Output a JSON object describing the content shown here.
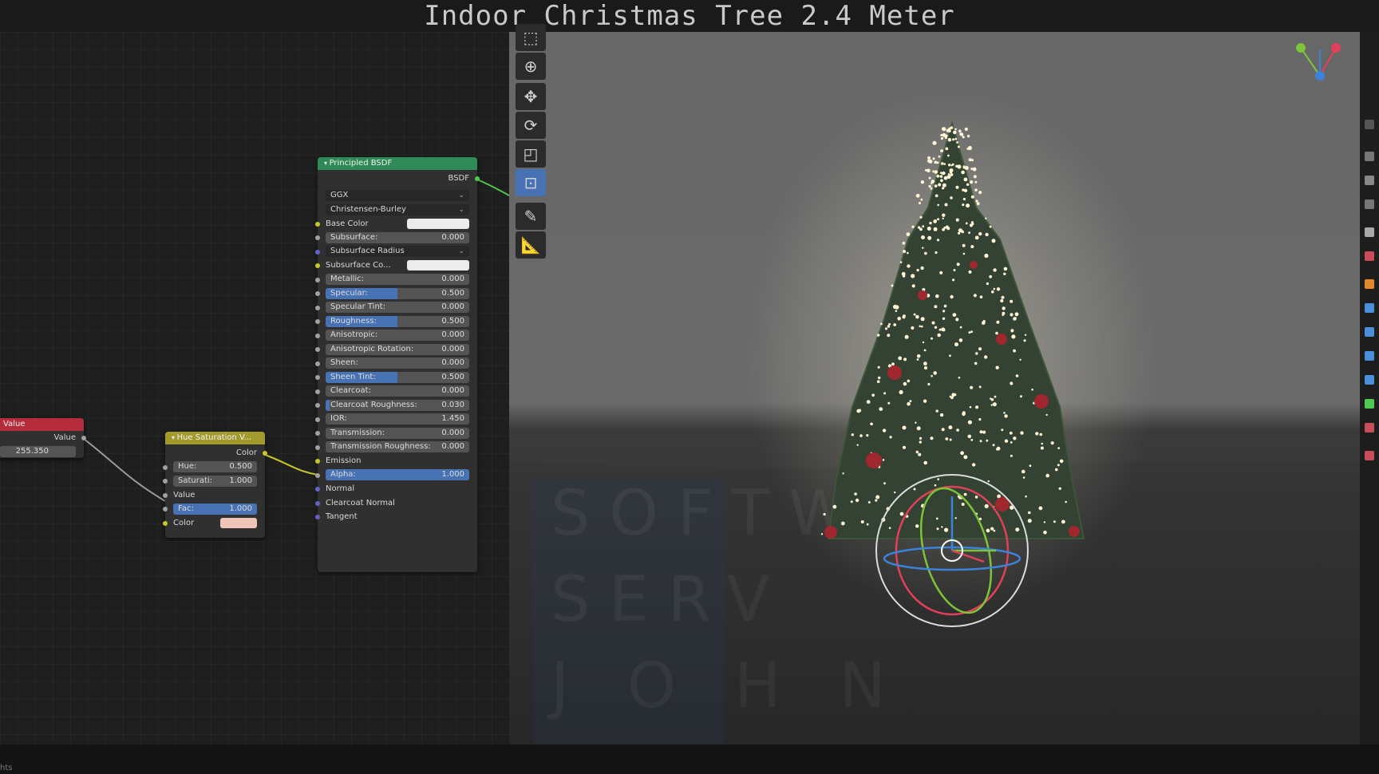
{
  "title": "Indoor Christmas Tree 2.4 Meter",
  "watermark": [
    "SOFTW",
    "SERV",
    "J O H N"
  ],
  "status": {
    "text": "hts"
  },
  "nodes": {
    "value": {
      "header": "Value",
      "output": "Value",
      "field_value": "255.350",
      "header_color": "#b52d3c"
    },
    "hsv": {
      "header": "Hue Saturation V...",
      "output": "Color",
      "hue_label": "Hue:",
      "hue_value": "0.500",
      "sat_label": "Saturati:",
      "sat_value": "1.000",
      "value_label": "Value",
      "fac_label": "Fac:",
      "fac_value": "1.000",
      "color_label": "Color",
      "color_swatch": "#f0c4b6",
      "header_color": "#a39a2e"
    },
    "bsdf": {
      "header": "Principled BSDF",
      "output": "BSDF",
      "distribution": "GGX",
      "subsurface_method": "Christensen-Burley",
      "header_color": "#2f8a57",
      "rows": [
        {
          "label": "Base Color",
          "kind": "color",
          "swatch": "#ececec"
        },
        {
          "label": "Subsurface:",
          "value": "0.000",
          "fill": 0
        },
        {
          "label": "Subsurface Radius",
          "kind": "dropdown"
        },
        {
          "label": "Subsurface Co...",
          "kind": "color",
          "swatch": "#ececec"
        },
        {
          "label": "Metallic:",
          "value": "0.000",
          "fill": 0
        },
        {
          "label": "Specular:",
          "value": "0.500",
          "fill": 0.5
        },
        {
          "label": "Specular Tint:",
          "value": "0.000",
          "fill": 0
        },
        {
          "label": "Roughness:",
          "value": "0.500",
          "fill": 0.5
        },
        {
          "label": "Anisotropic:",
          "value": "0.000",
          "fill": 0
        },
        {
          "label": "Anisotropic Rotation:",
          "value": "0.000",
          "fill": 0
        },
        {
          "label": "Sheen:",
          "value": "0.000",
          "fill": 0
        },
        {
          "label": "Sheen Tint:",
          "value": "0.500",
          "fill": 0.5
        },
        {
          "label": "Clearcoat:",
          "value": "0.000",
          "fill": 0
        },
        {
          "label": "Clearcoat Roughness:",
          "value": "0.030",
          "fill": 0.03
        },
        {
          "label": "IOR:",
          "value": "1.450",
          "fill": 0
        },
        {
          "label": "Transmission:",
          "value": "0.000",
          "fill": 0
        },
        {
          "label": "Transmission Roughness:",
          "value": "0.000",
          "fill": 0
        },
        {
          "label": "Emission",
          "kind": "socket"
        },
        {
          "label": "Alpha:",
          "value": "1.000",
          "fill": 1
        },
        {
          "label": "Normal",
          "kind": "socket"
        },
        {
          "label": "Clearcoat Normal",
          "kind": "socket"
        },
        {
          "label": "Tangent",
          "kind": "socket"
        }
      ]
    }
  },
  "toolbar": {
    "tools": [
      {
        "name": "select-tool",
        "glyph": "⬚"
      },
      {
        "name": "cursor-tool",
        "glyph": "⊕"
      },
      {
        "name": "move-tool",
        "glyph": "✥"
      },
      {
        "name": "rotate-tool",
        "glyph": "⟳"
      },
      {
        "name": "scale-tool",
        "glyph": "◰"
      },
      {
        "name": "transform-tool",
        "glyph": "⊡",
        "active": true
      },
      {
        "name": "annotate-tool",
        "glyph": "✎"
      },
      {
        "name": "measure-tool",
        "glyph": "📐"
      }
    ]
  },
  "colors": {
    "accent": "#4772b3",
    "gizmo_x": "#e0405a",
    "gizmo_y": "#7ec43a",
    "gizmo_z": "#3d82d9"
  }
}
